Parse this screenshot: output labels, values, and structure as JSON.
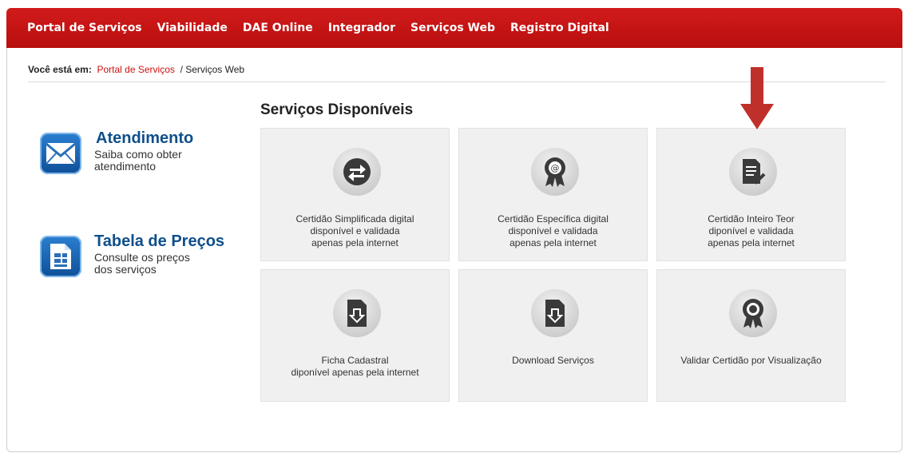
{
  "nav": {
    "items": [
      "Portal de Serviços",
      "Viabilidade",
      "DAE Online",
      "Integrador",
      "Serviços Web",
      "Registro Digital"
    ]
  },
  "breadcrumb": {
    "prefix": "Você está em:",
    "link": "Portal de Serviços",
    "current": "/ Serviços Web"
  },
  "section_title": "Serviços Disponíveis",
  "sidebar": {
    "atendimento": {
      "title": "Atendimento",
      "line1": "Saiba como obter",
      "line2": "atendimento",
      "icon": "envelope-icon"
    },
    "precos": {
      "title": "Tabela de Preços",
      "line1": "Consulte os preços",
      "line2": "dos serviços",
      "icon": "document-icon"
    }
  },
  "tiles": [
    {
      "icon": "refresh-arrows-icon",
      "lines": [
        "Certidão Simplificada digital",
        "disponível e validada",
        "apenas pela internet"
      ]
    },
    {
      "icon": "certificate-seal-icon",
      "lines": [
        "Certidão Específica digital",
        "disponível e validada",
        "apenas pela internet"
      ]
    },
    {
      "icon": "document-check-icon",
      "lines": [
        "Certidão Inteiro Teor",
        "diponível e validada",
        "apenas pela internet"
      ]
    },
    {
      "icon": "file-download-icon",
      "lines": [
        "Ficha Cadastral",
        "diponível apenas pela internet"
      ]
    },
    {
      "icon": "file-download-icon",
      "lines": [
        "Download Serviços"
      ]
    },
    {
      "icon": "certificate-seal-icon",
      "lines": [
        "Validar Certidão por Visualização"
      ]
    }
  ],
  "colors": {
    "nav_red": "#c41414",
    "link_red": "#cc1111",
    "sidebar_blue": "#0f4f8a",
    "annotation_arrow": "#c0302b"
  }
}
